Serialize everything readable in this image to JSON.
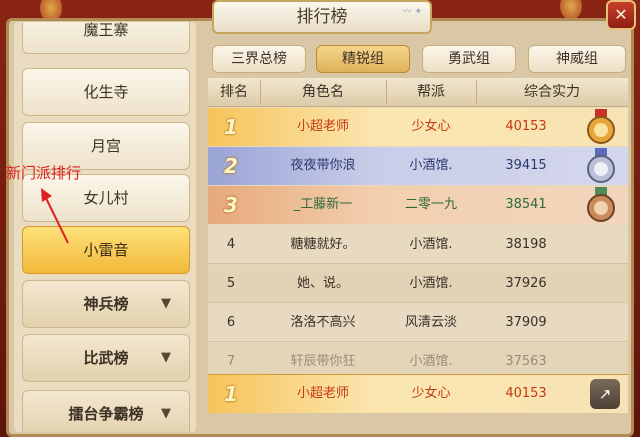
{
  "window": {
    "title": "排行榜",
    "close_icon": "close-icon"
  },
  "annotation": {
    "text": "新门派排行",
    "color": "#e02020"
  },
  "sidebar": {
    "items": [
      {
        "label": "魔王寨",
        "type": "item"
      },
      {
        "label": "化生寺",
        "type": "item"
      },
      {
        "label": "月宫",
        "type": "item"
      },
      {
        "label": "女儿村",
        "type": "item"
      },
      {
        "label": "小雷音",
        "type": "item",
        "active": true
      },
      {
        "label": "神兵榜",
        "type": "menu"
      },
      {
        "label": "比武榜",
        "type": "menu"
      },
      {
        "label": "擂台争霸榜",
        "type": "menu"
      }
    ]
  },
  "tabs": [
    {
      "label": "三界总榜"
    },
    {
      "label": "精锐组",
      "active": true
    },
    {
      "label": "勇武组"
    },
    {
      "label": "神威组"
    }
  ],
  "table": {
    "headers": [
      "排名",
      "角色名",
      "帮派",
      "综合实力"
    ],
    "rows": [
      {
        "rank": "1",
        "name": "小超老师",
        "guild": "少女心",
        "power": "40153"
      },
      {
        "rank": "2",
        "name": "夜夜带你浪",
        "guild": "小酒馆.",
        "power": "39415"
      },
      {
        "rank": "3",
        "name": "_工藤新一",
        "guild": "二零一九",
        "power": "38541"
      },
      {
        "rank": "4",
        "name": "糖糖就好。",
        "guild": "小酒馆.",
        "power": "38198"
      },
      {
        "rank": "5",
        "name": "她、说。",
        "guild": "小酒馆.",
        "power": "37926"
      },
      {
        "rank": "6",
        "name": "洛洛不高兴",
        "guild": "风清云淡",
        "power": "37909"
      },
      {
        "rank": "7",
        "name": "轩辰带你狂",
        "guild": "小酒馆.",
        "power": "37563"
      }
    ]
  },
  "my_rank": {
    "rank": "1",
    "name": "小超老师",
    "guild": "少女心",
    "power": "40153",
    "share_icon": "share-icon"
  }
}
